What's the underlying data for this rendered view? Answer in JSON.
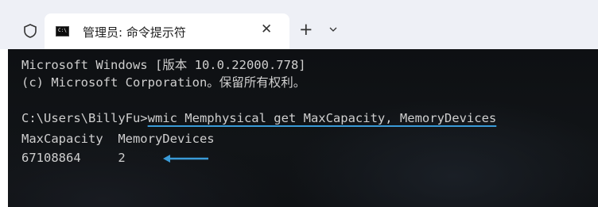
{
  "window": {
    "tab_title": "管理员: 命令提示符",
    "tab_icon_text": "C:\\",
    "close_glyph": "✕",
    "new_tab_glyph": "+"
  },
  "console": {
    "lines": [
      "Microsoft Windows [版本 10.0.22000.778]",
      "(c) Microsoft Corporation。保留所有权利。"
    ],
    "prompt": "C:\\Users\\BillyFu>",
    "command": "wmic Memphysical get MaxCapacity, MemoryDevices",
    "output_header": "MaxCapacity  MemoryDevices",
    "output_row": "67108864     2"
  },
  "colors": {
    "terminal_bg": "#101215",
    "terminal_text": "#cfcfcf",
    "accent_arrow": "#3a9bd8",
    "tabbar_bg": "#eef0f6"
  }
}
